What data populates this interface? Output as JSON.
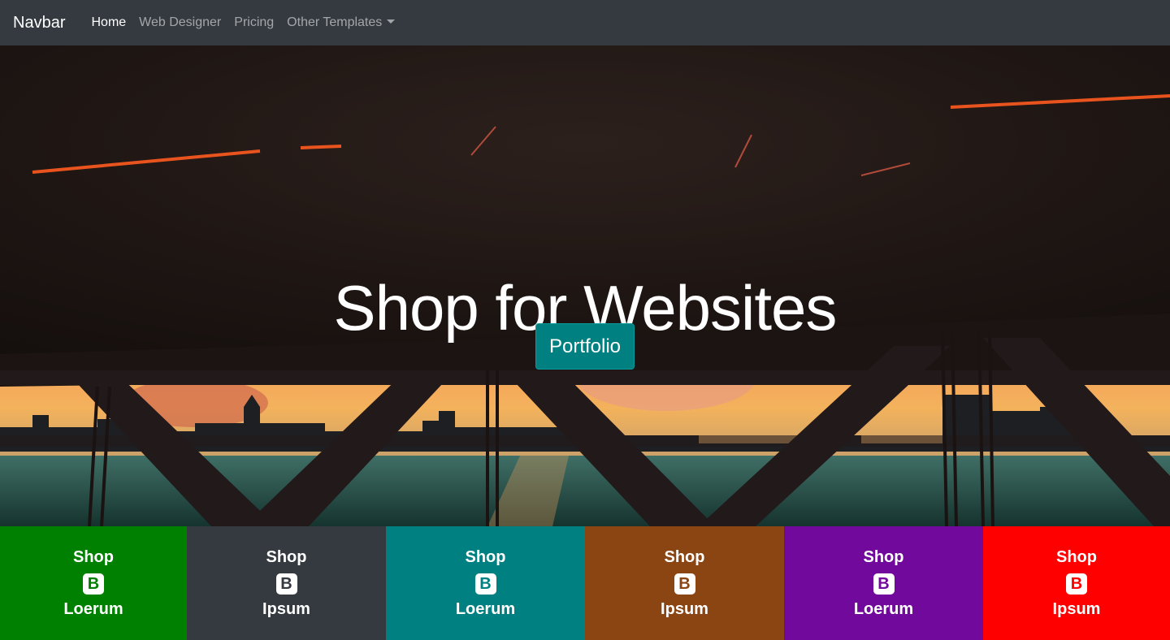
{
  "navbar": {
    "brand": "Navbar",
    "links": [
      {
        "label": "Home",
        "active": true
      },
      {
        "label": "Web Designer",
        "active": false
      },
      {
        "label": "Pricing",
        "active": false
      },
      {
        "label": "Other Templates",
        "active": false
      }
    ]
  },
  "hero": {
    "title": "Shop for Websites",
    "button": "Portfolio"
  },
  "tiles": [
    {
      "top": "Shop",
      "icon": "B",
      "bottom": "Loerum",
      "color": "#008000",
      "icon_name": "bootstrap-icon"
    },
    {
      "top": "Shop",
      "icon": "B",
      "bottom": "Ipsum",
      "color": "#343a40",
      "icon_name": "bootstrap-icon"
    },
    {
      "top": "Shop",
      "icon": "B",
      "bottom": "Loerum",
      "color": "#008080",
      "icon_name": "bootstrap-icon"
    },
    {
      "top": "Shop",
      "icon": "B",
      "bottom": "Ipsum",
      "color": "#8b4513",
      "icon_name": "bootstrap-icon"
    },
    {
      "top": "Shop",
      "icon": "B",
      "bottom": "Loerum",
      "color": "#71099c",
      "icon_name": "bootstrap-icon"
    },
    {
      "top": "Shop",
      "icon": "B",
      "bottom": "Ipsum",
      "color": "#ff0000",
      "icon_name": "bootstrap-icon"
    }
  ]
}
